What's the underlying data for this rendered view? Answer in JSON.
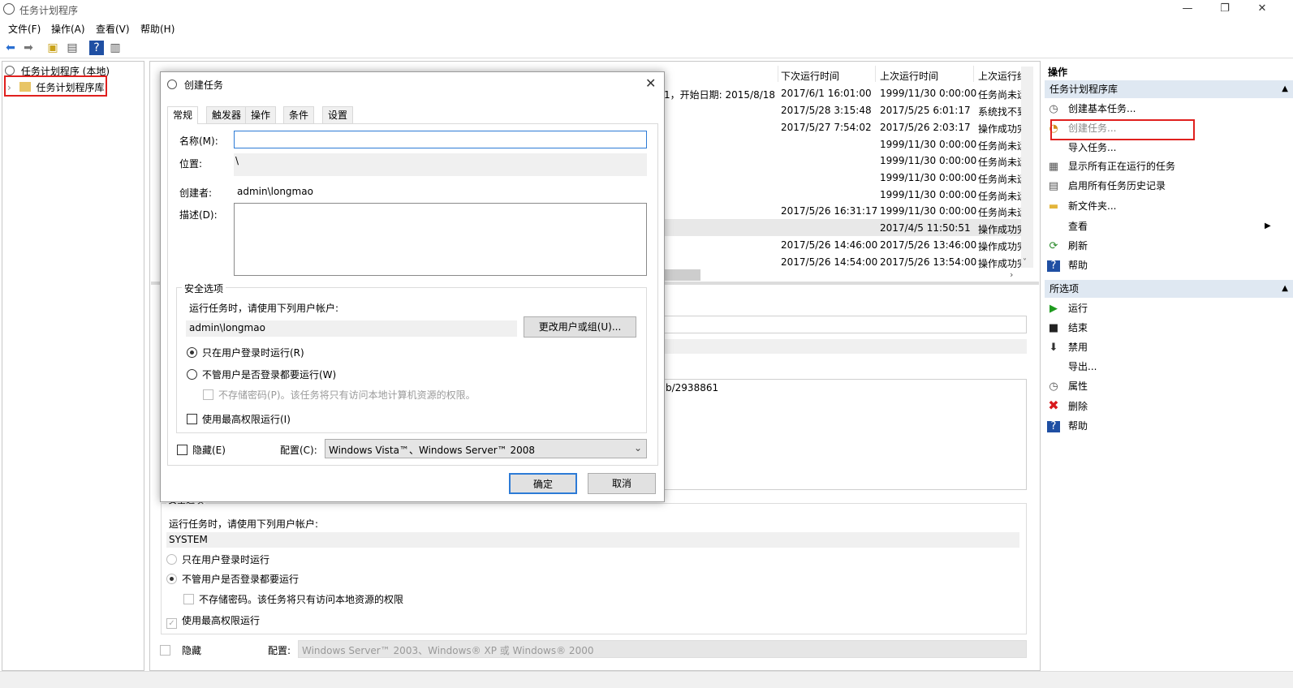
{
  "window": {
    "title": "任务计划程序"
  },
  "menu": [
    "文件(F)",
    "操作(A)",
    "查看(V)",
    "帮助(H)"
  ],
  "tree": {
    "root": "任务计划程序 (本地)",
    "library": "任务计划程序库"
  },
  "columns": {
    "next_run": "下次运行时间",
    "last_run": "上次运行时间",
    "last_result": "上次运行结"
  },
  "rows": [
    {
      "info": "1，开始日期: 2015/8/18",
      "next": "2017/6/1 16:01:00",
      "last": "1999/11/30 0:00:00",
      "result": "任务尚未运"
    },
    {
      "info": "",
      "next": "2017/5/28 3:15:48",
      "last": "2017/5/25 6:01:17",
      "result": "系统找不到"
    },
    {
      "info": "",
      "next": "2017/5/27 7:54:02",
      "last": "2017/5/26 2:03:17",
      "result": "操作成功完"
    },
    {
      "info": "",
      "next": "",
      "last": "1999/11/30 0:00:00",
      "result": "任务尚未运"
    },
    {
      "info": "",
      "next": "",
      "last": "1999/11/30 0:00:00",
      "result": "任务尚未运"
    },
    {
      "info": "",
      "next": "",
      "last": "1999/11/30 0:00:00",
      "result": "任务尚未运"
    },
    {
      "info": "",
      "next": "",
      "last": "1999/11/30 0:00:00",
      "result": "任务尚未运"
    },
    {
      "info": "",
      "next": "2017/5/26 16:31:17",
      "last": "1999/11/30 0:00:00",
      "result": "任务尚未运"
    },
    {
      "info": "",
      "next": "",
      "last": "2017/4/5 11:50:51",
      "result": "操作成功完"
    },
    {
      "info": "",
      "next": "2017/5/26 14:46:00",
      "last": "2017/5/26 13:46:00",
      "result": "操作成功完"
    },
    {
      "info": "",
      "next": "2017/5/26 14:54:00",
      "last": "2017/5/26 13:54:00",
      "result": "操作成功完"
    }
  ],
  "actions": {
    "header": "操作",
    "section1": "任务计划程序库",
    "items1": [
      "创建基本任务...",
      "创建任务...",
      "导入任务...",
      "显示所有正在运行的任务",
      "启用所有任务历史记录",
      "新文件夹...",
      "查看",
      "刷新",
      "帮助"
    ],
    "section2": "所选项",
    "items2": [
      "运行",
      "结束",
      "禁用",
      "导出...",
      "属性",
      "删除",
      "帮助"
    ]
  },
  "background": {
    "link_fragment": "b/2938861",
    "security_title": "安全选项",
    "run_as_label": "运行任务时，请使用下列用户帐户:",
    "run_as_user": "SYSTEM",
    "opt_logged_on": "只在用户登录时运行",
    "opt_always": "不管用户是否登录都要运行",
    "opt_nopwd": "不存储密码。该任务将只有访问本地资源的权限",
    "opt_highest": "使用最高权限运行",
    "hidden": "隐藏",
    "config_label": "配置:",
    "config_value": "Windows Server™ 2003、Windows® XP 或 Windows® 2000"
  },
  "dialog": {
    "title": "创建任务",
    "tabs": [
      "常规",
      "触发器",
      "操作",
      "条件",
      "设置"
    ],
    "name_label": "名称(M):",
    "name_value": "",
    "location_label": "位置:",
    "location_value": "\\",
    "author_label": "创建者:",
    "author_value": "admin\\longmao",
    "desc_label": "描述(D):",
    "security_title": "安全选项",
    "run_as_label": "运行任务时，请使用下列用户帐户:",
    "run_as_user": "admin\\longmao",
    "change_user_button": "更改用户或组(U)...",
    "opt_logged_on": "只在用户登录时运行(R)",
    "opt_always": "不管用户是否登录都要运行(W)",
    "opt_nopwd": "不存储密码(P)。该任务将只有访问本地计算机资源的权限。",
    "opt_highest": "使用最高权限运行(I)",
    "hidden": "隐藏(E)",
    "config_label": "配置(C):",
    "config_value": "Windows Vista™、Windows Server™ 2008",
    "ok": "确定",
    "cancel": "取消"
  }
}
